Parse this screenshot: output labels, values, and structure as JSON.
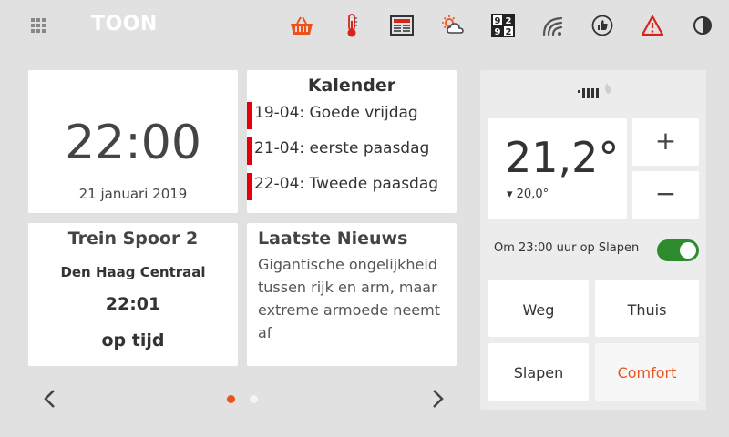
{
  "header": {
    "logo": "TOON",
    "icons": [
      "apps-grid-icon",
      "shopping-basket-icon",
      "thermometer-icon",
      "newspaper-icon",
      "weather-icon",
      "sudoku-icon",
      "wifi-icon",
      "thumbs-up-icon",
      "warning-icon",
      "contrast-icon"
    ],
    "sudoku_digits": [
      "9",
      "2",
      "9",
      "2"
    ],
    "accent_color": "#e8531f",
    "warning_color": "#d9241c"
  },
  "clock": {
    "time": "22:00",
    "date": "21 januari 2019"
  },
  "calendar": {
    "title": "Kalender",
    "events": [
      "19-04: Goede vrijdag",
      "21-04: eerste paasdag",
      "22-04: Tweede paasdag"
    ],
    "event_color": "#e3000b"
  },
  "train": {
    "title": "Trein Spoor 2",
    "station": "Den Haag Centraal",
    "departure": "22:01",
    "status": "op tijd"
  },
  "news": {
    "title": "Laatste Nieuws",
    "headline": "Gigantische ongelijkheid tussen rijk en arm, maar extreme armoede neemt af"
  },
  "pager": {
    "current": 1,
    "total": 2
  },
  "thermostat": {
    "current_temp": "21,2°",
    "setpoint": "▾ 20,0°",
    "plus": "+",
    "minus": "−",
    "schedule_text": "Om 23:00 uur op Slapen",
    "schedule_on": true,
    "presets": [
      "Weg",
      "Thuis",
      "Slapen",
      "Comfort"
    ],
    "active_preset": "Comfort",
    "active_color": "#e8531f",
    "toggle_color": "#2d8a2d"
  }
}
